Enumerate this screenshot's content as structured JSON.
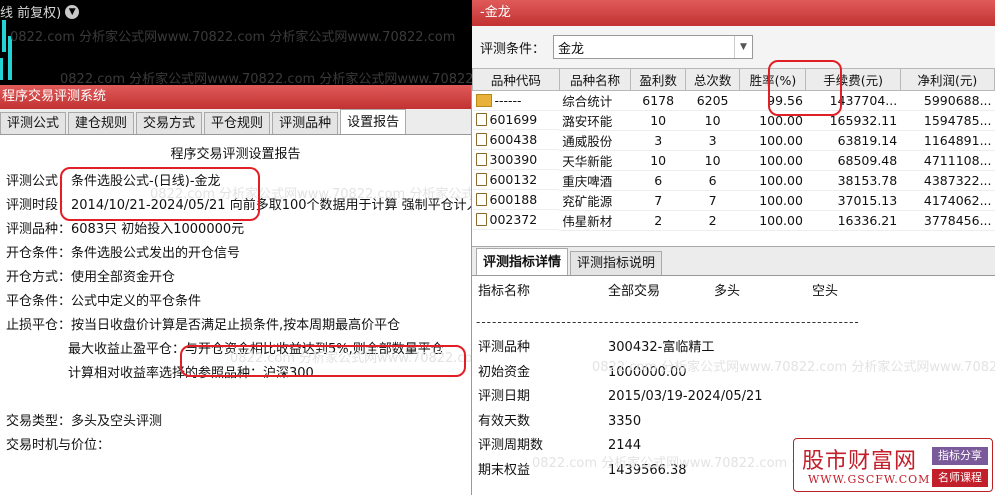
{
  "chart_header": {
    "title": "线 前复权)",
    "dropdown_icon": "chevron-down-icon"
  },
  "watermark": "0822.com 分析家公式网www.70822.com 分析家公式网www.70822.com",
  "left_window": {
    "title": "程序交易评测系统",
    "tabs": [
      "评测公式",
      "建仓规则",
      "交易方式",
      "平仓规则",
      "评测品种",
      "设置报告"
    ],
    "active_tab": 5,
    "report": {
      "heading": "程序交易评测设置报告",
      "lines": [
        {
          "key": "评测公式：",
          "value": "条件选股公式-(日线)-金龙"
        },
        {
          "key": "评测时段：",
          "value": "2014/10/21-2024/05/21 向前多取100个数据用于计算 强制平仓计入"
        },
        {
          "key": "评测品种：",
          "value": "6083只 初始投入1000000元"
        },
        {
          "key": "开仓条件：",
          "value": "条件选股公式发出的开仓信号"
        },
        {
          "key": "开仓方式：",
          "value": "使用全部资金开仓"
        },
        {
          "key": "平仓条件：",
          "value": "公式中定义的平仓条件"
        },
        {
          "key": "止损平仓：",
          "value": "按当日收盘价计算是否满足止损条件,按本周期最高价平仓"
        },
        {
          "key": "最大收益止盈平仓：",
          "value": "与开仓资金相比收益达到5%,则全部数量平仓",
          "indent": true
        },
        {
          "key": "计算相对收益率选择的参照品种：",
          "value": "沪深300",
          "indent": true
        },
        {
          "key": "",
          "value": ""
        },
        {
          "key": "交易类型：",
          "value": "多头及空头评测"
        },
        {
          "key": "交易时机与价位：",
          "value": ""
        }
      ]
    }
  },
  "right_window": {
    "title": "-金龙",
    "condition_label": "评测条件：",
    "condition_value": "金龙",
    "columns": [
      "品种代码",
      "品种名称",
      "盈利数",
      "总次数",
      "胜率(%)",
      "手续费(元)",
      "净利润(元)"
    ],
    "rows": [
      {
        "icon": "folder-icon",
        "code": "------",
        "name": "综合统计",
        "wins": "6178",
        "total": "6205",
        "rate": "99.56",
        "fee": "1437704...",
        "profit": "5990688..."
      },
      {
        "icon": "document-icon",
        "code": "601699",
        "name": "潞安环能",
        "wins": "10",
        "total": "10",
        "rate": "100.00",
        "fee": "165932.11",
        "profit": "1594785..."
      },
      {
        "icon": "document-icon",
        "code": "600438",
        "name": "通威股份",
        "wins": "3",
        "total": "3",
        "rate": "100.00",
        "fee": "63819.14",
        "profit": "1164891..."
      },
      {
        "icon": "document-icon",
        "code": "300390",
        "name": "天华新能",
        "wins": "10",
        "total": "10",
        "rate": "100.00",
        "fee": "68509.48",
        "profit": "4711108..."
      },
      {
        "icon": "document-icon",
        "code": "600132",
        "name": "重庆啤酒",
        "wins": "6",
        "total": "6",
        "rate": "100.00",
        "fee": "38153.78",
        "profit": "4387322..."
      },
      {
        "icon": "document-icon",
        "code": "600188",
        "name": "兖矿能源",
        "wins": "7",
        "total": "7",
        "rate": "100.00",
        "fee": "37015.13",
        "profit": "4174062..."
      },
      {
        "icon": "document-icon",
        "code": "002372",
        "name": "伟星新材",
        "wins": "2",
        "total": "2",
        "rate": "100.00",
        "fee": "16336.21",
        "profit": "3778456..."
      }
    ],
    "lower_tabs": [
      "评测指标详情",
      "评测指标说明"
    ],
    "active_lower_tab": 0,
    "detail_header": {
      "name": "指标名称",
      "all": "全部交易",
      "long": "多头",
      "short": "空头"
    },
    "dashes": "------------------------------------------------------------------------",
    "detail_rows": [
      {
        "key": "评测品种",
        "value": "300432-富临精工"
      },
      {
        "key": "初始资金",
        "value": "1000000.00"
      },
      {
        "key": "评测日期",
        "value": "2015/03/19-2024/05/21"
      },
      {
        "key": "有效天数",
        "value": "3350"
      },
      {
        "key": "评测周期数",
        "value": "2144"
      },
      {
        "key": "期末权益",
        "value": "1439566.38"
      }
    ]
  },
  "logo": {
    "main": "股市财富网",
    "url": "WWW.GSCFW.COM",
    "tag1": "指标分享",
    "tag2": "名师课程"
  },
  "colors": {
    "title_bar": "#c23232",
    "highlight": "#e21f26",
    "accent": "#22d4d4"
  }
}
